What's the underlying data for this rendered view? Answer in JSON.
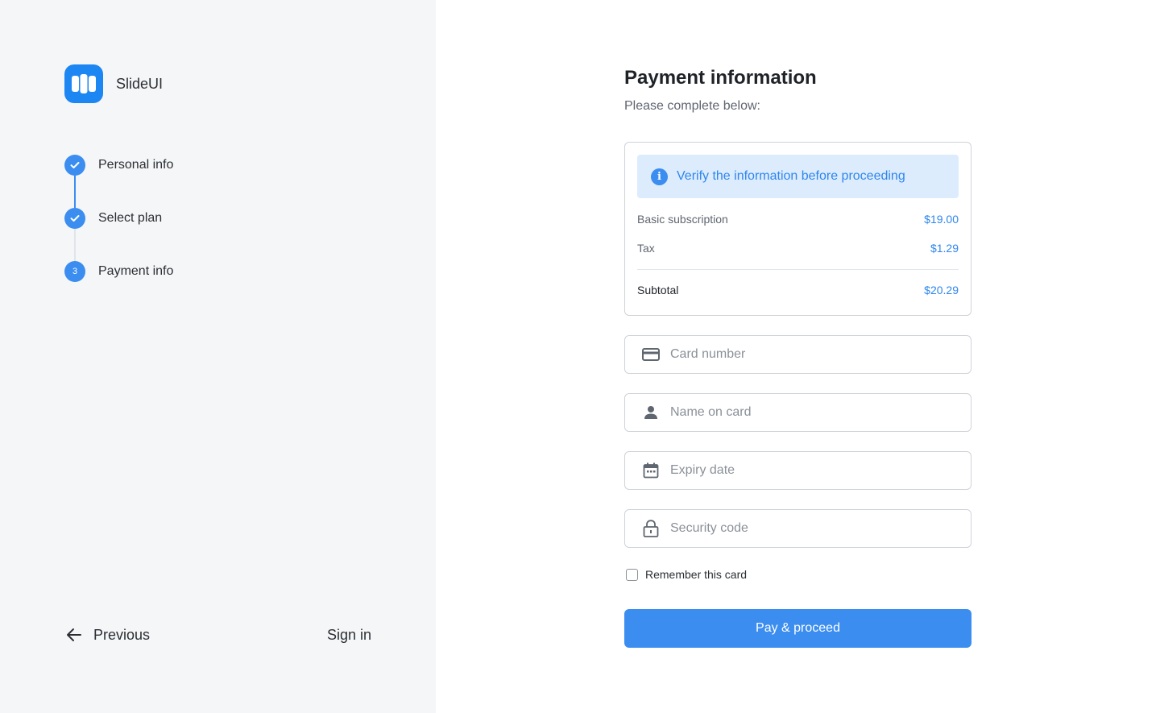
{
  "brand": {
    "name": "SlideUI",
    "icon": "slides-logo-icon",
    "color": "#1c86f2"
  },
  "steps": [
    {
      "label": "Personal info",
      "status": "complete",
      "icon": "check-icon"
    },
    {
      "label": "Select plan",
      "status": "complete",
      "icon": "check-icon"
    },
    {
      "label": "Payment info",
      "status": "current",
      "number": "3"
    }
  ],
  "nav": {
    "previous_label": "Previous",
    "previous_icon": "arrow-left-icon",
    "signin_label": "Sign in"
  },
  "main": {
    "title": "Payment information",
    "subtitle": "Please complete below:"
  },
  "summary": {
    "alert_text": "Verify the information before proceeding",
    "alert_icon": "info-icon",
    "items": [
      {
        "label": "Basic subscription",
        "value": "$19.00"
      },
      {
        "label": "Tax",
        "value": "$1.29"
      }
    ],
    "subtotal": {
      "label": "Subtotal",
      "value": "$20.29"
    }
  },
  "fields": [
    {
      "placeholder": "Card number",
      "value": "",
      "icon": "credit-card-icon"
    },
    {
      "placeholder": "Name on card",
      "value": "",
      "icon": "person-icon"
    },
    {
      "placeholder": "Expiry date",
      "value": "",
      "icon": "calendar-icon"
    },
    {
      "placeholder": "Security code",
      "value": "",
      "icon": "lock-icon"
    }
  ],
  "remember": {
    "label": "Remember this card",
    "checked": false
  },
  "submit": {
    "label": "Pay & proceed"
  },
  "colors": {
    "accent": "#3b8df0",
    "accent_text": "#2f86ee",
    "alert_bg": "#dcecfd",
    "sidebar_bg": "#f5f6f8"
  }
}
